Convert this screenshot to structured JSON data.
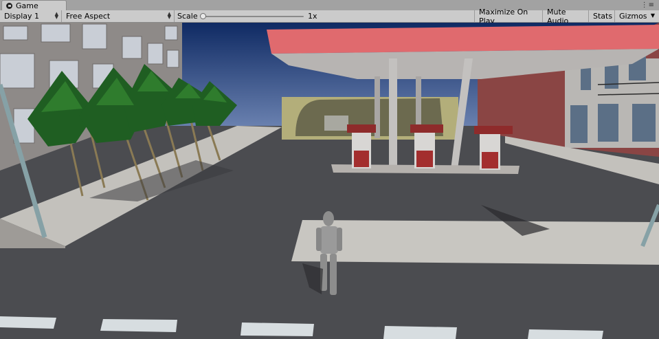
{
  "window": {
    "tab_title": "Game",
    "tab_menu_glyph": "⋮≡"
  },
  "toolbar": {
    "display": "Display 1",
    "aspect": "Free Aspect",
    "scale_label": "Scale",
    "scale_value_text": "1x",
    "scale_value": 1,
    "maximize_on_play": "Maximize On Play",
    "mute_audio": "Mute Audio",
    "stats": "Stats",
    "gizmos": "Gizmos"
  },
  "icons": {
    "tab_icon": "unity-game-icon",
    "dropdown_arrows": "updown-arrows-icon",
    "gizmos_arrow": "chevron-down-icon"
  },
  "colors": {
    "editor_bg": "#cbcbcb",
    "sky": "#1d3a73",
    "canopy": "#e06a6e",
    "ground": "#4b4c50"
  }
}
